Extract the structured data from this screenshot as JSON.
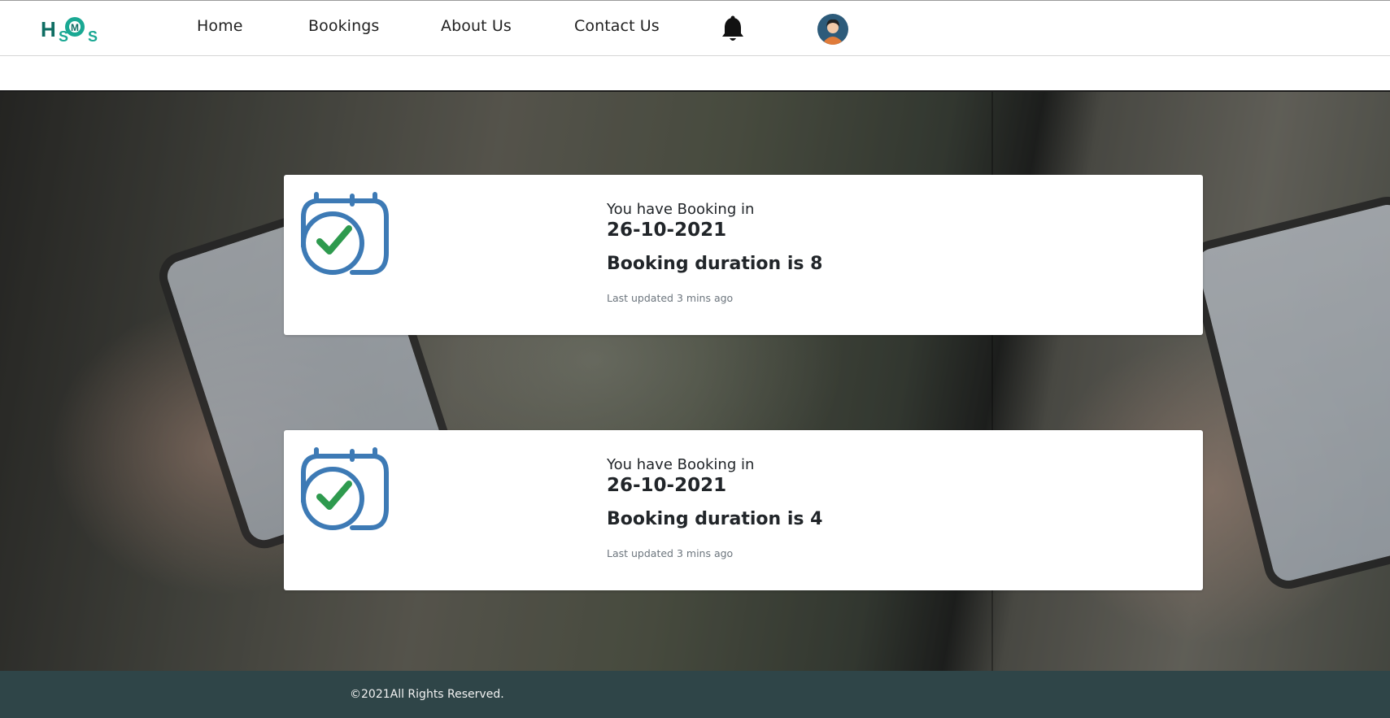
{
  "nav": {
    "logo_text": "HSMS",
    "links": [
      "Home",
      "Bookings",
      "About Us",
      "Contact Us"
    ],
    "bell_icon": "bell-icon",
    "avatar_icon": "user-avatar-icon"
  },
  "bookings": [
    {
      "intro": "You have Booking in",
      "date": "26-10-2021",
      "duration_text": "Booking duration is 8",
      "updated": "Last updated 3 mins ago",
      "icon": "calendar-check-icon"
    },
    {
      "intro": "You have Booking in",
      "date": "26-10-2021",
      "duration_text": "Booking duration is 4",
      "updated": "Last updated 3 mins ago",
      "icon": "calendar-check-icon"
    }
  ],
  "footer": {
    "text": "©2021All Rights Reserved."
  },
  "colors": {
    "footer_bg": "#2f4548",
    "icon_blue": "#3d7ab5",
    "icon_green": "#2e9a4e",
    "logo_teal": "#1a9a8a"
  }
}
